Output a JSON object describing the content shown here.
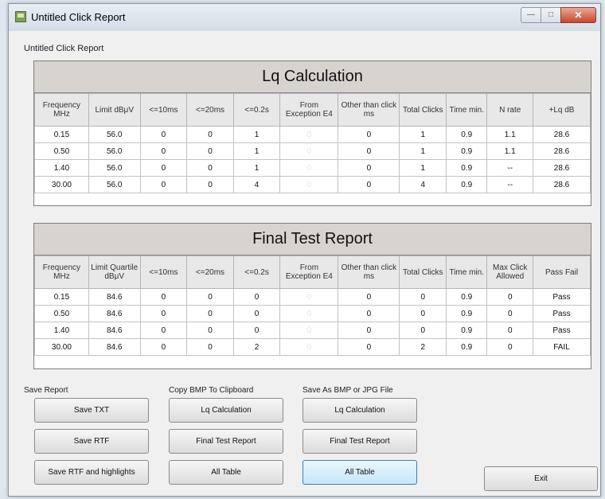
{
  "window": {
    "title": "Untitled Click Report"
  },
  "report_label": "Untitled Click Report",
  "lq": {
    "title": "Lq Calculation",
    "headers": [
      "Frequency MHz",
      "Limit dBμV",
      "<=10ms",
      "<=20ms",
      "<=0.2s",
      "From Exception E4",
      "Other than click ms",
      "Total Clicks",
      "Time min.",
      "N rate",
      "+Lq dB"
    ],
    "rows": [
      [
        "0.15",
        "56.0",
        "0",
        "0",
        "1",
        "0",
        "0",
        "1",
        "0.9",
        "1.1",
        "28.6"
      ],
      [
        "0.50",
        "56.0",
        "0",
        "0",
        "1",
        "0",
        "0",
        "1",
        "0.9",
        "1.1",
        "28.6"
      ],
      [
        "1.40",
        "56.0",
        "0",
        "0",
        "1",
        "0",
        "0",
        "1",
        "0.9",
        "--",
        "28.6"
      ],
      [
        "30.00",
        "56.0",
        "0",
        "0",
        "4",
        "0",
        "0",
        "4",
        "0.9",
        "--",
        "28.6"
      ]
    ]
  },
  "final": {
    "title": "Final Test Report",
    "headers": [
      "Frequency MHz",
      "Limit Quartile dBμV",
      "<=10ms",
      "<=20ms",
      "<=0.2s",
      "From Exception E4",
      "Other than click ms",
      "Total Clicks",
      "Time min.",
      "Max Click Allowed",
      "Pass Fail"
    ],
    "rows": [
      [
        "0.15",
        "84.6",
        "0",
        "0",
        "0",
        "0",
        "0",
        "0",
        "0.9",
        "0",
        "Pass"
      ],
      [
        "0.50",
        "84.6",
        "0",
        "0",
        "0",
        "0",
        "0",
        "0",
        "0.9",
        "0",
        "Pass"
      ],
      [
        "1.40",
        "84.6",
        "0",
        "0",
        "0",
        "0",
        "0",
        "0",
        "0.9",
        "0",
        "Pass"
      ],
      [
        "30.00",
        "84.6",
        "0",
        "0",
        "2",
        "0",
        "0",
        "2",
        "0.9",
        "0",
        "FAIL"
      ]
    ]
  },
  "save_report": {
    "label": "Save Report",
    "txt": "Save TXT",
    "rtf": "Save RTF",
    "rtf_highlights": "Save RTF and highlights"
  },
  "copy_bmp": {
    "label": "Copy BMP To Clipboard",
    "lq": "Lq Calculation",
    "final": "Final Test Report",
    "all": "All Table"
  },
  "save_bmp": {
    "label": "Save As BMP or JPG File",
    "lq": "Lq Calculation",
    "final": "Final Test Report",
    "all": "All Table"
  },
  "exit": "Exit"
}
